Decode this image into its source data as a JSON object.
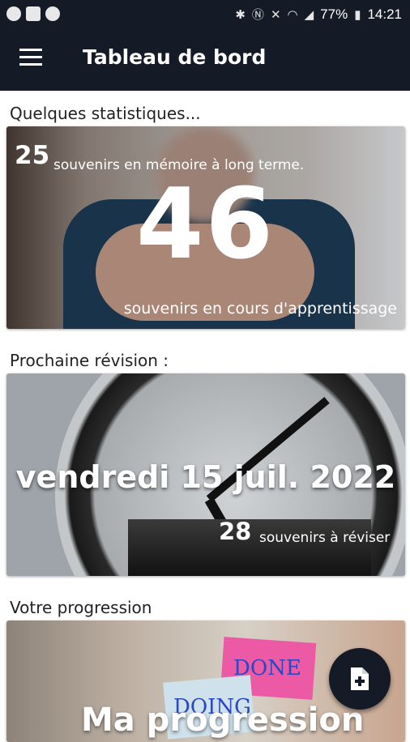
{
  "status_bar": {
    "battery": "77%",
    "time": "14:21",
    "icons": [
      "notification-icon",
      "message-icon",
      "notification-icon",
      "bluetooth-icon",
      "nfc-icon",
      "mute-icon",
      "wifi-icon",
      "signal-icon",
      "battery-icon"
    ]
  },
  "app_bar": {
    "title": "Tableau de bord",
    "menu_icon": "hamburger-menu-icon"
  },
  "sections": {
    "stats_label": "Quelques statistiques...",
    "next_review_label": "Prochaine révision :",
    "progress_label": "Votre progression"
  },
  "stats": {
    "long_term_count": "25",
    "long_term_text": "souvenirs en mémoire à long terme.",
    "learning_count": "46",
    "learning_text": "souvenirs en cours d'apprentissage"
  },
  "review": {
    "date": "vendredi 15 juil. 2022",
    "count": "28",
    "text": "souvenirs à réviser"
  },
  "progress": {
    "title": "Ma progression",
    "note_done": "DONE",
    "note_doing": "DOING"
  },
  "fab": {
    "icon": "add-file-icon"
  },
  "colors": {
    "app_bar": "#141a26",
    "accent": "#141a26"
  }
}
